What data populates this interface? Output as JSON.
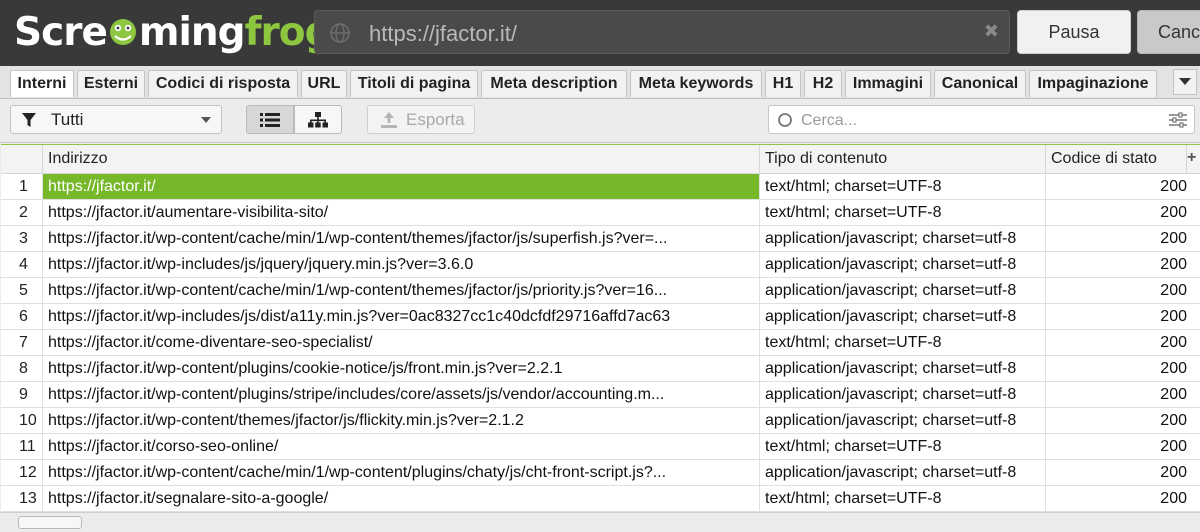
{
  "app": {
    "logo": {
      "part1": "Scre",
      "part2": "ming",
      "part3": "frog"
    },
    "url": "https://jfactor.it/",
    "buttons": {
      "pause": "Pausa",
      "cancel": "Canc"
    },
    "colors": {
      "brand_green": "#8dc63f",
      "selected_row": "#77b82a",
      "topbar": "#393939"
    }
  },
  "tabs": [
    {
      "label": "Interni",
      "active": true
    },
    {
      "label": "Esterni"
    },
    {
      "label": "Codici di risposta"
    },
    {
      "label": "URL"
    },
    {
      "label": "Titoli di pagina"
    },
    {
      "label": "Meta description"
    },
    {
      "label": "Meta keywords"
    },
    {
      "label": "H1"
    },
    {
      "label": "H2"
    },
    {
      "label": "Immagini"
    },
    {
      "label": "Canonical"
    },
    {
      "label": "Impaginazione"
    }
  ],
  "toolbar": {
    "filter_label": "Tutti",
    "export_label": "Esporta",
    "search_placeholder": "Cerca..."
  },
  "table": {
    "columns": [
      "Indirizzo",
      "Tipo di contenuto",
      "Codice di stato"
    ],
    "rows": [
      {
        "n": "1",
        "address": "https://jfactor.it/",
        "type": "text/html; charset=UTF-8",
        "code": "200"
      },
      {
        "n": "2",
        "address": "https://jfactor.it/aumentare-visibilita-sito/",
        "type": "text/html; charset=UTF-8",
        "code": "200"
      },
      {
        "n": "3",
        "address": "https://jfactor.it/wp-content/cache/min/1/wp-content/themes/jfactor/js/superfish.js?ver=...",
        "type": "application/javascript; charset=utf-8",
        "code": "200"
      },
      {
        "n": "4",
        "address": "https://jfactor.it/wp-includes/js/jquery/jquery.min.js?ver=3.6.0",
        "type": "application/javascript; charset=utf-8",
        "code": "200"
      },
      {
        "n": "5",
        "address": "https://jfactor.it/wp-content/cache/min/1/wp-content/themes/jfactor/js/priority.js?ver=16...",
        "type": "application/javascript; charset=utf-8",
        "code": "200"
      },
      {
        "n": "6",
        "address": "https://jfactor.it/wp-includes/js/dist/a11y.min.js?ver=0ac8327cc1c40dcfdf29716affd7ac63",
        "type": "application/javascript; charset=utf-8",
        "code": "200"
      },
      {
        "n": "7",
        "address": "https://jfactor.it/come-diventare-seo-specialist/",
        "type": "text/html; charset=UTF-8",
        "code": "200"
      },
      {
        "n": "8",
        "address": "https://jfactor.it/wp-content/plugins/cookie-notice/js/front.min.js?ver=2.2.1",
        "type": "application/javascript; charset=utf-8",
        "code": "200"
      },
      {
        "n": "9",
        "address": "https://jfactor.it/wp-content/plugins/stripe/includes/core/assets/js/vendor/accounting.m...",
        "type": "application/javascript; charset=utf-8",
        "code": "200"
      },
      {
        "n": "10",
        "address": "https://jfactor.it/wp-content/themes/jfactor/js/flickity.min.js?ver=2.1.2",
        "type": "application/javascript; charset=utf-8",
        "code": "200"
      },
      {
        "n": "11",
        "address": "https://jfactor.it/corso-seo-online/",
        "type": "text/html; charset=UTF-8",
        "code": "200"
      },
      {
        "n": "12",
        "address": "https://jfactor.it/wp-content/cache/min/1/wp-content/plugins/chaty/js/cht-front-script.js?...",
        "type": "application/javascript; charset=utf-8",
        "code": "200"
      },
      {
        "n": "13",
        "address": "https://jfactor.it/segnalare-sito-a-google/",
        "type": "text/html; charset=UTF-8",
        "code": "200"
      }
    ]
  }
}
